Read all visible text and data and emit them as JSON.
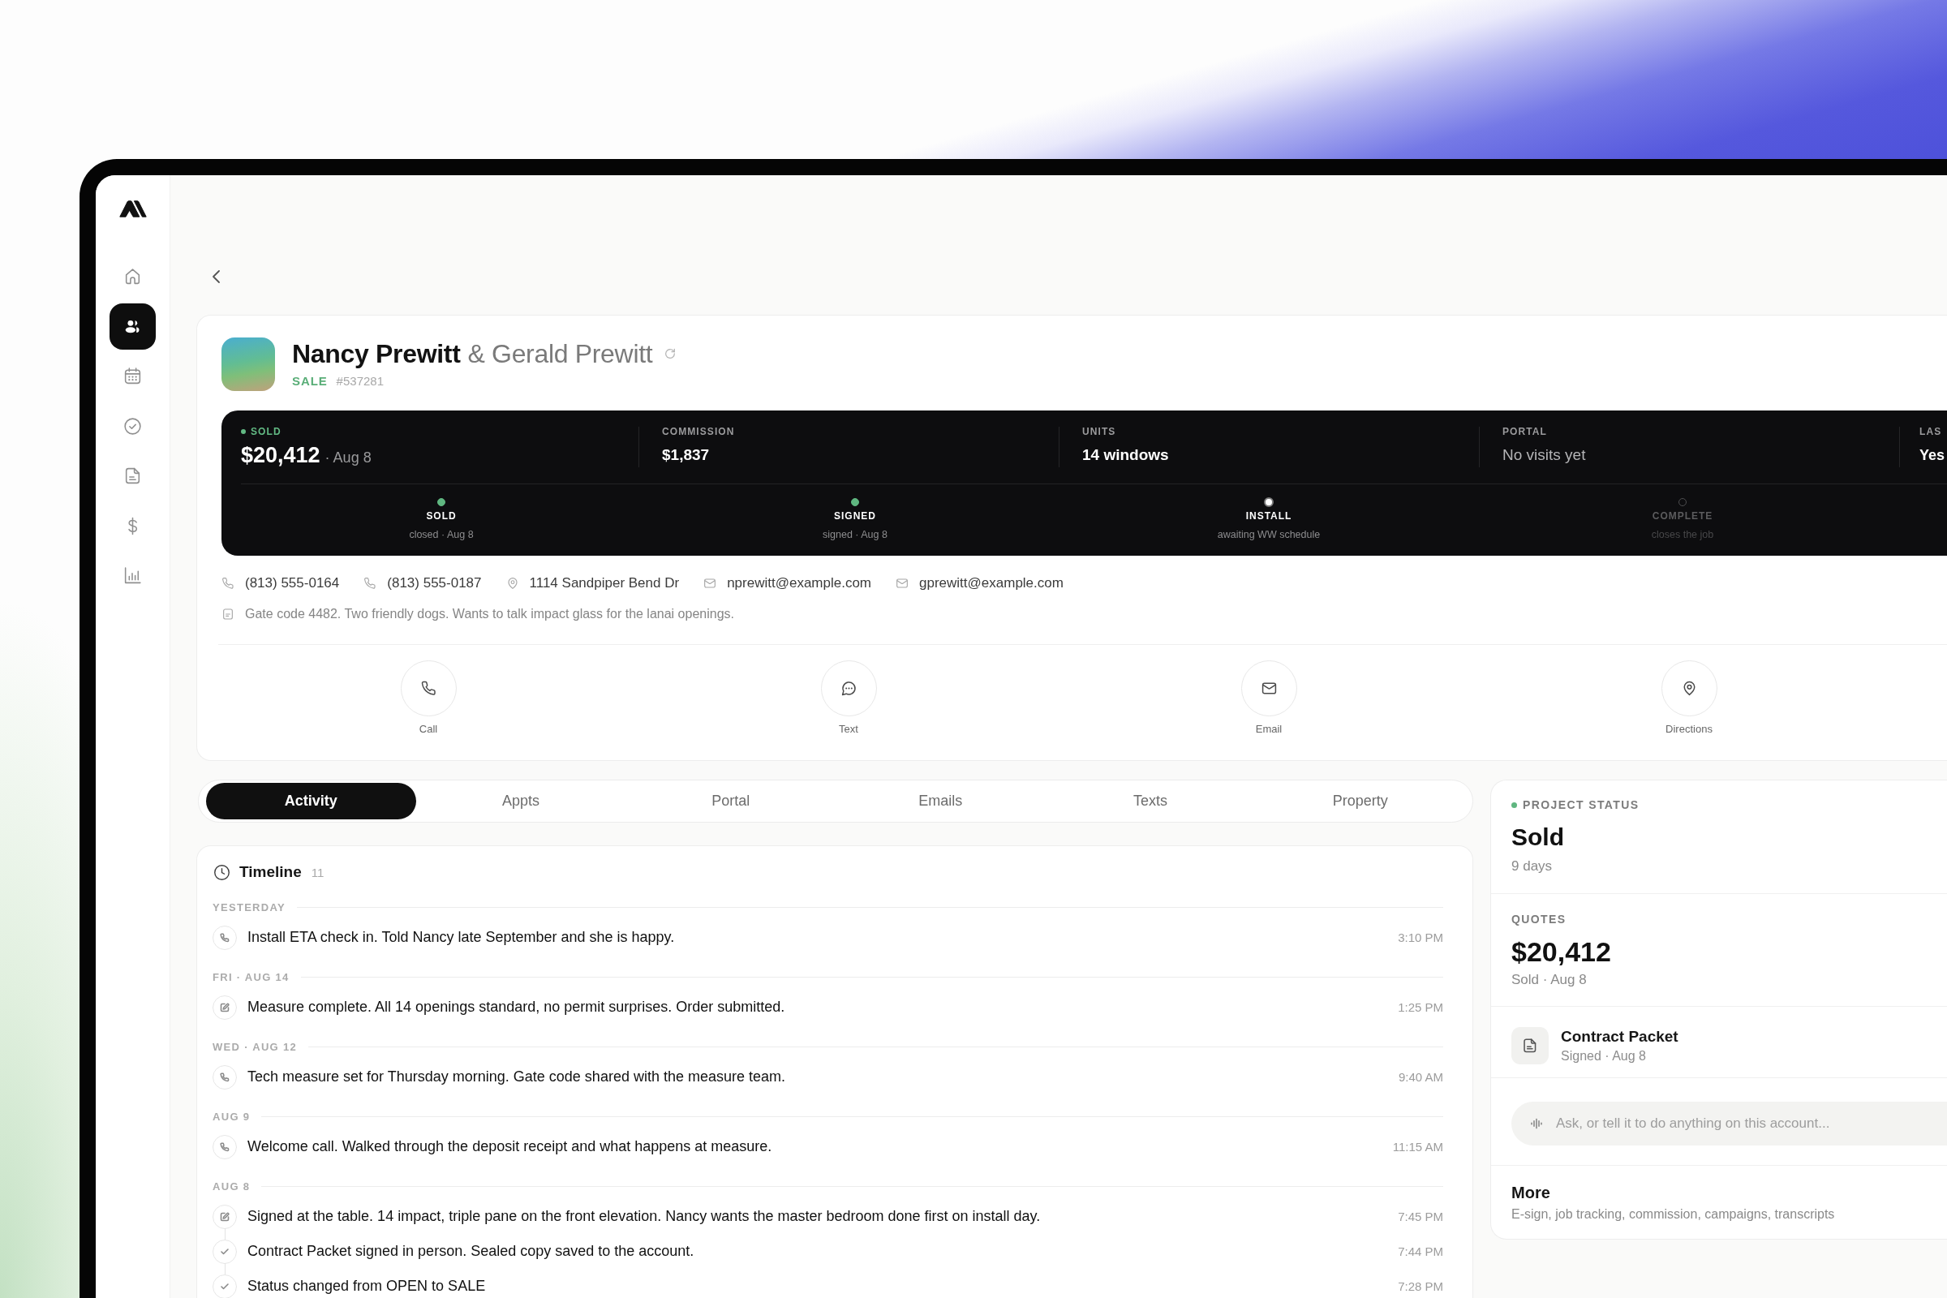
{
  "sidebar": {
    "items": [
      {
        "selected": false
      },
      {
        "selected": true
      },
      {
        "selected": false
      },
      {
        "selected": false
      },
      {
        "selected": false
      },
      {
        "selected": false
      },
      {
        "selected": false
      }
    ]
  },
  "customer": {
    "name": "Nancy Prewitt",
    "partner": "& Gerald Prewitt",
    "stage": "SALE",
    "number": "#537281"
  },
  "stats": [
    {
      "kind": "status",
      "label": "SOLD",
      "value": "$20,412",
      "detail": "· Aug 8"
    },
    {
      "kind": "metric",
      "label": "COMMISSION",
      "value": "$1,837"
    },
    {
      "kind": "metric",
      "label": "UNITS",
      "value": "14 windows"
    },
    {
      "kind": "empty",
      "label": "PORTAL",
      "value": "No visits yet"
    },
    {
      "kind": "metric",
      "label": "LAS",
      "value": "Yes"
    }
  ],
  "stages": [
    {
      "label": "SOLD",
      "detail": "closed · Aug 8",
      "done": true,
      "current": false
    },
    {
      "label": "SIGNED",
      "detail": "signed · Aug 8",
      "done": true,
      "current": false
    },
    {
      "label": "INSTALL",
      "detail": "awaiting WW schedule",
      "done": false,
      "current": true
    },
    {
      "label": "COMPLETE",
      "detail": "closes the job",
      "done": false,
      "current": false
    }
  ],
  "contacts": [
    {
      "kind": "phone",
      "text": "(813) 555-0164"
    },
    {
      "kind": "phone",
      "text": "(813) 555-0187"
    },
    {
      "kind": "address",
      "text": "1114 Sandpiper Bend Dr"
    },
    {
      "kind": "email",
      "text": "nprewitt@example.com"
    },
    {
      "kind": "email",
      "text": "gprewitt@example.com"
    }
  ],
  "note": "Gate code 4482. Two friendly dogs. Wants to talk impact glass for the lanai openings.",
  "actions": [
    {
      "kind": "call",
      "label": "Call"
    },
    {
      "kind": "text",
      "label": "Text"
    },
    {
      "kind": "email",
      "label": "Email"
    },
    {
      "kind": "directions",
      "label": "Directions"
    }
  ],
  "tabs": [
    {
      "label": "Activity",
      "selected": true
    },
    {
      "label": "Appts",
      "selected": false
    },
    {
      "label": "Portal",
      "selected": false
    },
    {
      "label": "Emails",
      "selected": false
    },
    {
      "label": "Texts",
      "selected": false
    },
    {
      "label": "Property",
      "selected": false
    }
  ],
  "timeline": {
    "title": "Timeline",
    "count": "11",
    "groups": [
      {
        "date": "YESTERDAY",
        "entries": [
          {
            "kind": "call",
            "text": "Install ETA check in. Told Nancy late September and she is happy.",
            "time": "3:10 PM"
          }
        ]
      },
      {
        "date": "FRI · AUG 14",
        "entries": [
          {
            "kind": "note",
            "text": "Measure complete. All 14 openings standard, no permit surprises. Order submitted.",
            "time": "1:25 PM"
          }
        ]
      },
      {
        "date": "WED · AUG 12",
        "entries": [
          {
            "kind": "call",
            "text": "Tech measure set for Thursday morning. Gate code shared with the measure team.",
            "time": "9:40 AM"
          }
        ]
      },
      {
        "date": "AUG 9",
        "entries": [
          {
            "kind": "call",
            "text": "Welcome call. Walked through the deposit receipt and what happens at measure.",
            "time": "11:15 AM"
          }
        ]
      },
      {
        "date": "AUG 8",
        "entries": [
          {
            "kind": "note",
            "text": "Signed at the table. 14 impact, triple pane on the front elevation. Nancy wants the master bedroom done first on install day.",
            "time": "7:45 PM"
          },
          {
            "kind": "status",
            "text": "Contract Packet signed in person. Sealed copy saved to the account.",
            "time": "7:44 PM"
          },
          {
            "kind": "status",
            "text": "Status changed from OPEN to SALE",
            "time": "7:28 PM"
          }
        ]
      }
    ]
  },
  "project_status": {
    "label": "PROJECT STATUS",
    "value": "Sold",
    "detail": "9 days"
  },
  "quotes": {
    "label": "QUOTES",
    "value": "$20,412",
    "detail": "Sold · Aug 8"
  },
  "document": {
    "title": "Contract Packet",
    "detail": "Signed · Aug 8"
  },
  "assistant": {
    "placeholder": "Ask, or tell it to do anything on this account..."
  },
  "more": {
    "title": "More",
    "detail": "E-sign, job tracking, commission, campaigns, transcripts"
  }
}
